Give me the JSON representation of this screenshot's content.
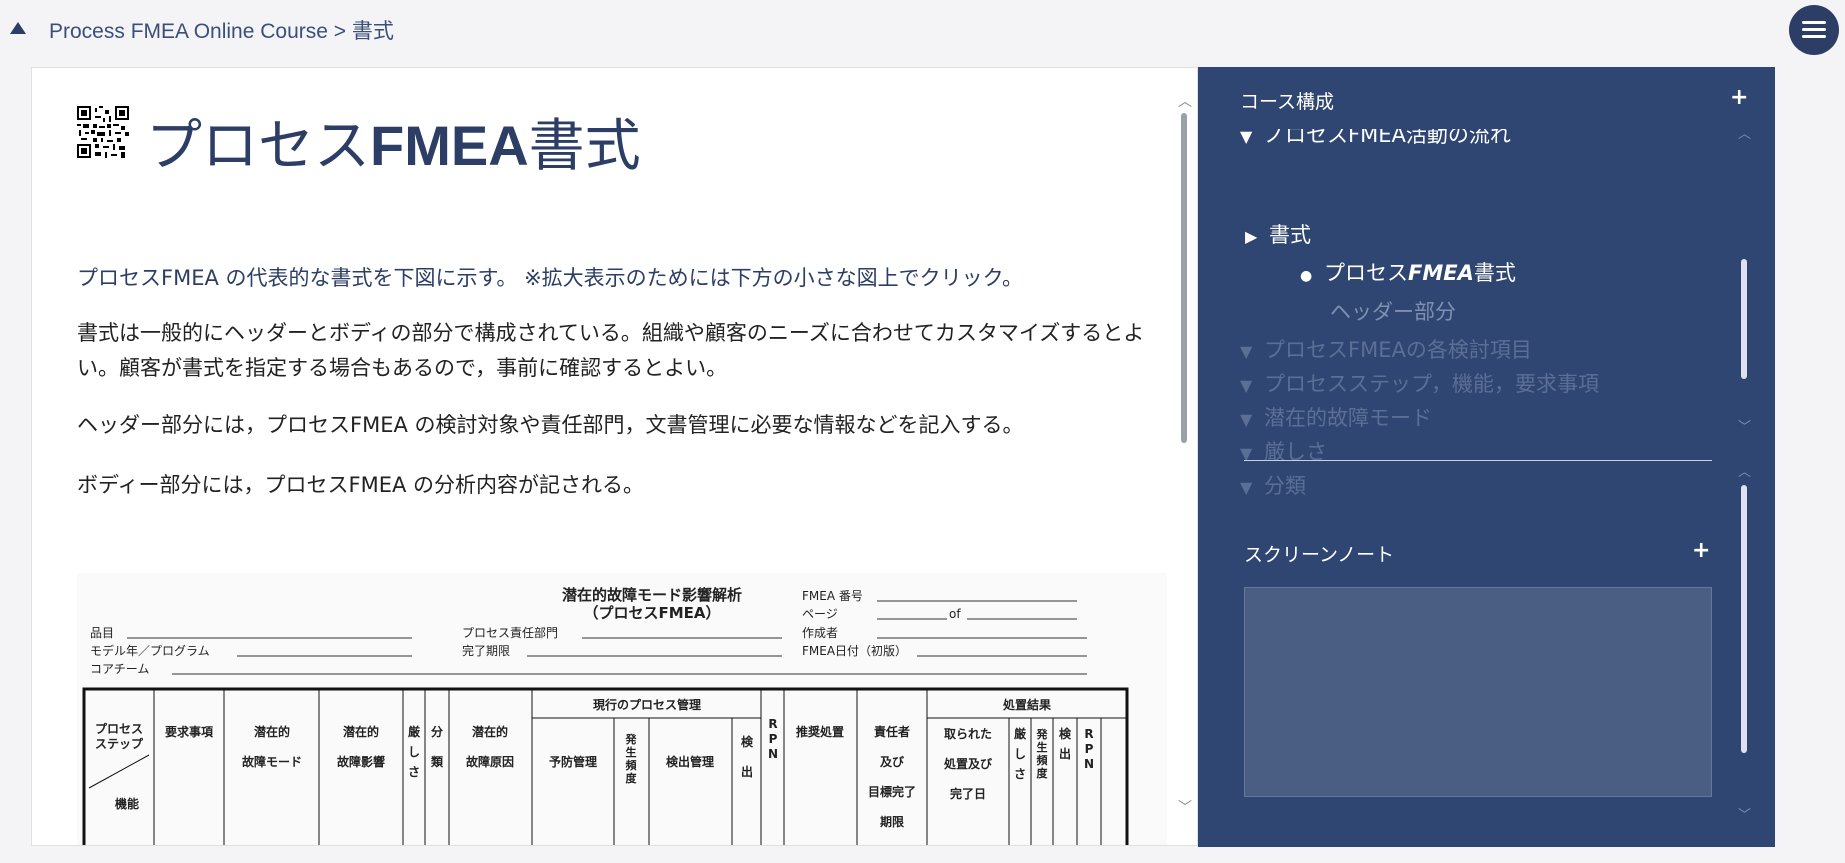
{
  "breadcrumb": "Process FMEA Online Course > 書式",
  "page": {
    "title_prefix": "プロセス",
    "title_bold": "FMEA",
    "title_suffix": "書式",
    "paragraphs": [
      "プロセスFMEA の代表的な書式を下図に示す。 ※拡大表示のためには下方の小さな図上でクリック。",
      "書式は一般的にヘッダーとボディの部分で構成されている。組織や顧客のニーズに合わせてカスタマイズするとよい。顧客が書式を指定する場合もあるので，事前に確認するとよい。",
      "ヘッダー部分には，プロセスFMEA の検討対象や責任部門，文書管理に必要な情報などを記入する。",
      "ボディー部分には，プロセスFMEA の分析内容が記される。"
    ]
  },
  "form": {
    "title": "潜在的故障モード影響解析",
    "subtitle": "（プロセスFMEA）",
    "fields_left": [
      "品目",
      "モデル年／プログラム",
      "コアチーム"
    ],
    "fields_mid": [
      "プロセス責任部門",
      "完了期限"
    ],
    "fields_right": [
      "FMEA 番号",
      "ページ",
      "作成者",
      "FMEA日付（初版）"
    ],
    "page_of": "of",
    "group_current": "現行のプロセス管理",
    "group_results": "処置結果",
    "col_process": "プロセス",
    "col_step": "ステップ",
    "col_function": "機能",
    "col_requirements": "要求事項",
    "col_failure_mode_1": "潜在的",
    "col_failure_mode_2": "故障モード",
    "col_effect_1": "潜在的",
    "col_effect_2": "故障影響",
    "col_severity": [
      "厳",
      "し",
      "さ"
    ],
    "col_class": [
      "分",
      "類"
    ],
    "col_cause_1": "潜在的",
    "col_cause_2": "故障原因",
    "col_prevention": "予防管理",
    "col_occurrence": [
      "発",
      "生",
      "頻",
      "度"
    ],
    "col_detection_ctrl": "検出管理",
    "col_detection": [
      "検",
      "出"
    ],
    "col_rpn": [
      "R",
      "P",
      "N"
    ],
    "col_recommended": "推奨処置",
    "col_responsibility": [
      "責任者",
      "及び",
      "目標完了",
      "期限"
    ],
    "col_taken": [
      "取られた",
      "処置及び",
      "完了日"
    ],
    "col_r_sev": [
      "厳",
      "し",
      "さ"
    ],
    "col_r_occ": [
      "発",
      "生",
      "頻",
      "度"
    ],
    "col_r_det": [
      "検",
      "出"
    ],
    "col_r_rpn": [
      "R",
      "P",
      "N"
    ]
  },
  "sidebar": {
    "course_header": "コース構成",
    "plus": "+",
    "toc": [
      {
        "label": "ノロセスFMEA活動の流れ",
        "arrow": "▼"
      },
      {
        "label": "書式",
        "arrow": "▶"
      },
      {
        "label_prefix": "プロセス",
        "label_bold": "FMEA",
        "label_suffix": "書式",
        "arrow": "●"
      },
      {
        "label": "ヘッダー部分"
      },
      {
        "label": "プロセスFMEAの各検討項目",
        "arrow": "▼"
      },
      {
        "label": "プロセスステップ，機能，要求事項",
        "arrow": "▼"
      },
      {
        "label": "潜在的故障モード",
        "arrow": "▼"
      },
      {
        "label": "厳しさ",
        "arrow": "▼"
      },
      {
        "label": "分類",
        "arrow": "▼"
      }
    ],
    "notes_header": "スクリーンノート",
    "notes_value": ""
  },
  "icons": {
    "collapse": "triangle-up-icon",
    "menu": "hamburger-menu-icon",
    "qr": "qr-code-icon"
  },
  "colors": {
    "primary": "#2c3e66",
    "sidebar_bg": "#2f4672",
    "note_bg": "#4a5d82",
    "background": "#f4f4f6"
  }
}
